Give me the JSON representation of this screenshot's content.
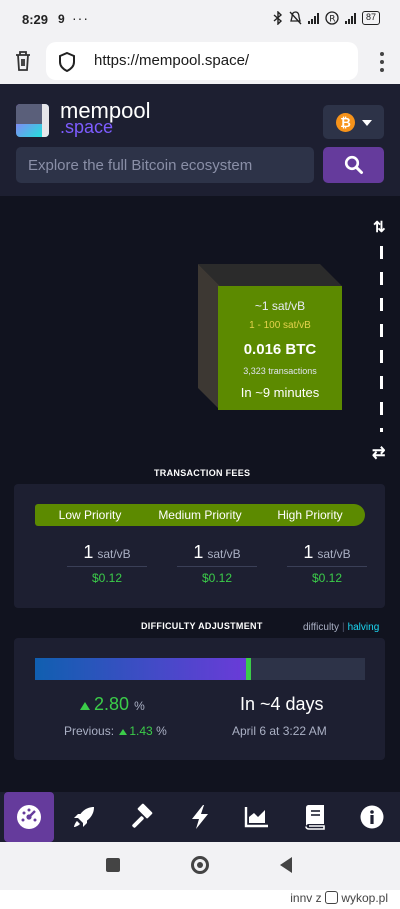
{
  "status_bar": {
    "time": "8:29",
    "network_badge": "9",
    "battery": "87"
  },
  "browser": {
    "url": "https://mempool.space/"
  },
  "header": {
    "logo_line1": "mempool",
    "logo_line2": ".space",
    "network_symbol": "₿",
    "search_placeholder": "Explore the full Bitcoin ecosystem"
  },
  "block": {
    "median_fee": "~1 sat/vB",
    "fee_range": "1 - 100 sat/vB",
    "total": "0.016 BTC",
    "tx_count": "3,323 transactions",
    "eta": "In ~9 minutes"
  },
  "fees": {
    "title": "TRANSACTION FEES",
    "priorities": [
      {
        "label": "Low Priority",
        "rate": "1",
        "unit": "sat/vB",
        "usd": "$0.12"
      },
      {
        "label": "Medium Priority",
        "rate": "1",
        "unit": "sat/vB",
        "usd": "$0.12"
      },
      {
        "label": "High Priority",
        "rate": "1",
        "unit": "sat/vB",
        "usd": "$0.12"
      }
    ]
  },
  "difficulty": {
    "title": "DIFFICULTY ADJUSTMENT",
    "link_difficulty": "difficulty",
    "link_halving": "halving",
    "progress": 0.64,
    "change": "2.80",
    "change_unit": "%",
    "previous_label": "Previous:",
    "previous_value": "1.43",
    "previous_unit": "%",
    "eta": "In ~4 days",
    "eta_date": "April 6 at 3:22 AM"
  },
  "watermark": {
    "user": "innv",
    "separator": "z",
    "site": "wykop.pl"
  },
  "colors": {
    "background": "#11131f",
    "card": "#1d1f31",
    "accent_purple": "#653b9c",
    "fee_green": "#5c8a00",
    "positive_green": "#3bcc49",
    "bitcoin_orange": "#f7931a"
  },
  "icons": {
    "bottom_nav": [
      "dashboard-icon",
      "rocket-icon",
      "hammer-icon",
      "lightning-icon",
      "chart-icon",
      "book-icon",
      "info-icon"
    ]
  }
}
